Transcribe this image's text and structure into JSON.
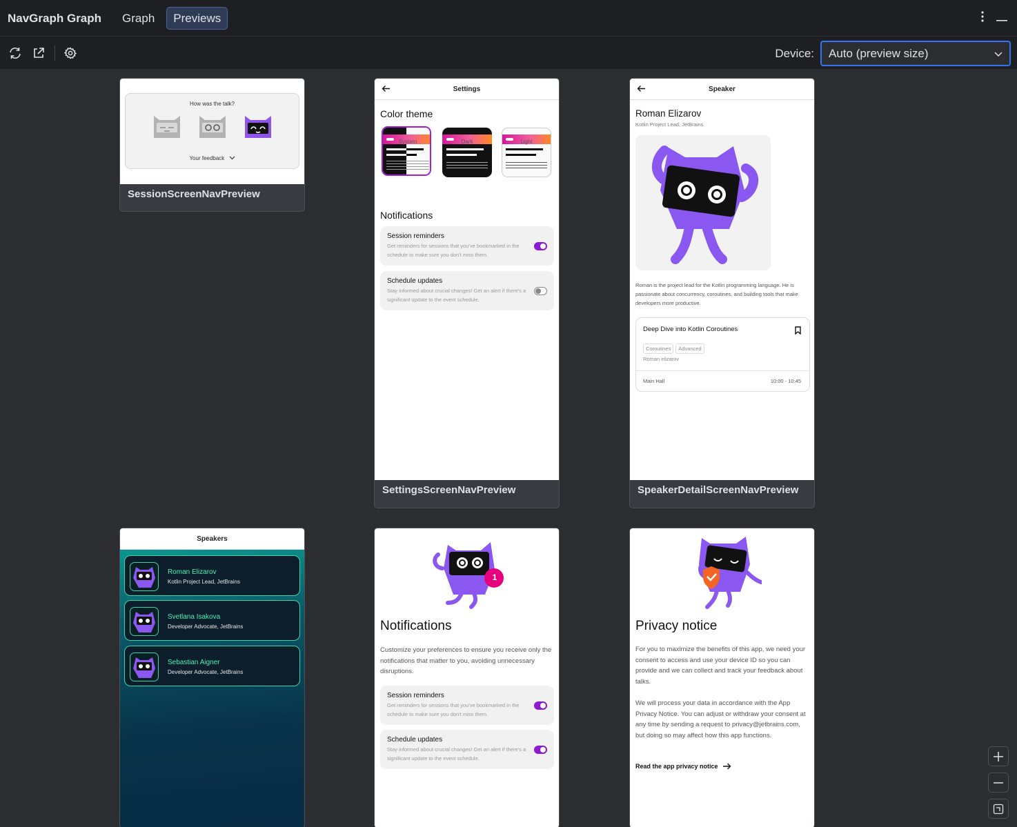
{
  "window": {
    "title": "NavGraph Graph",
    "tabs": [
      {
        "label": "Graph",
        "selected": false
      },
      {
        "label": "Previews",
        "selected": true
      }
    ]
  },
  "toolbar": {
    "icons": [
      "refresh-icon",
      "open-external-icon",
      "settings-icon"
    ],
    "device_label": "Device:",
    "device_value": "Auto (preview size)"
  },
  "colors": {
    "accent": "#3574f0",
    "app_purple": "#8c19d6",
    "speaker_green": "#39d6a4"
  },
  "previews": [
    {
      "name": "SessionScreenNavPreview",
      "question": "How was the talk?",
      "feedback": "Your feedback"
    },
    {
      "name": "SettingsScreenNavPreview",
      "title": "Settings",
      "color_theme": "Color theme",
      "themes": [
        "System",
        "Dark",
        "Light"
      ],
      "notifications": "Notifications",
      "items": [
        {
          "title": "Session reminders",
          "desc": "Get reminders for sessions that you've bookmarked in the schedule to make sure you don't miss them.",
          "on": true
        },
        {
          "title": "Schedule updates",
          "desc": "Stay informed about crucial changes! Get an alert if there's a significant update to the event schedule.",
          "on": false
        }
      ]
    },
    {
      "name": "SpeakerDetailScreenNavPreview",
      "title": "Speaker",
      "speaker_name": "Roman Elizarov",
      "speaker_title": "Kotlin Project Lead, JetBrains",
      "bio": "Roman is the project lead for the Kotlin programming language. He is passionate about concurrency, coroutines, and building tools that make developers more productive.",
      "session": {
        "title": "Deep Dive into Kotlin Coroutines",
        "tags": [
          "Coroutines",
          "Advanced"
        ],
        "speaker": "Roman elizarov",
        "room": "Main Hall",
        "time": "10:00 - 10:45"
      }
    },
    {
      "title": "Speakers",
      "speakers": [
        {
          "name": "Roman Elizarov",
          "role": "Kotlin Project Lead, JetBrains"
        },
        {
          "name": "Svetlana Isakova",
          "role": "Developer Advocate, JetBrains"
        },
        {
          "name": "Sebastian Aigner",
          "role": "Developer Advocate, JetBrains"
        }
      ]
    },
    {
      "title": "Notifications",
      "badge": "1",
      "desc": "Customize your preferences to ensure you receive only the notifications that matter to you, avoiding unnecessary disruptions.",
      "items": [
        {
          "title": "Session reminders",
          "desc": "Get reminders for sessions that you've bookmarked in the schedule to make sure you don't miss them.",
          "on": true
        },
        {
          "title": "Schedule updates",
          "desc": "Stay informed about crucial changes! Get an alert if there's a significant update to the event schedule.",
          "on": true
        }
      ]
    },
    {
      "title": "Privacy notice",
      "p1": "For you to maximize the benefits of this app, we need your consent to access and use your device ID so you can provide and we can collect and track your feedback about talks.",
      "p2": "We will process your data in accordance with the App Privacy Notice. You can adjust or withdraw your consent at any time by sending a request to privacy@jetbrains.com, but doing so may affect how this app functions.",
      "link": "Read the app privacy notice"
    }
  ]
}
